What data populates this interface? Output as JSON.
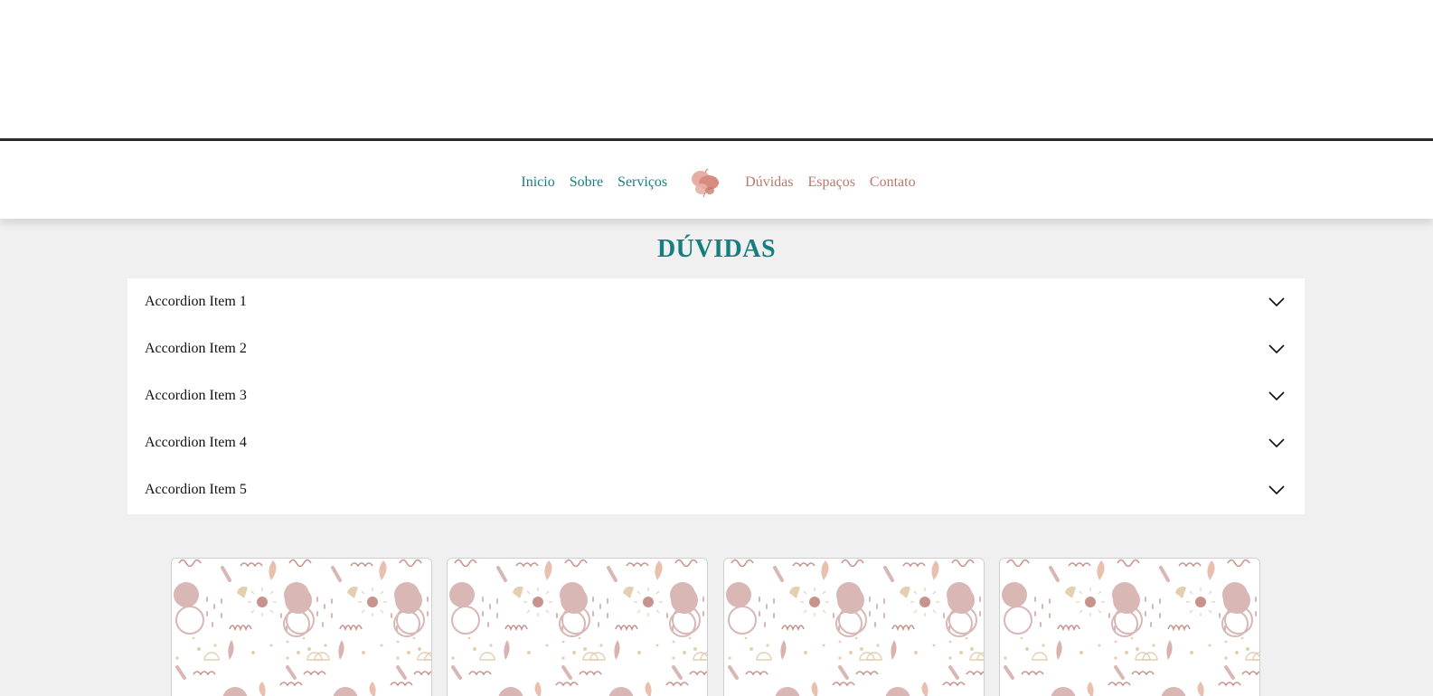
{
  "nav": {
    "left_links": [
      "Inicio",
      "Sobre",
      "Serviços"
    ],
    "right_links": [
      "Dúvidas",
      "Espaços",
      "Contato"
    ],
    "logo_icon": "butterfly-logo-icon",
    "colors": {
      "left": "#177e80",
      "right": "#b8786a"
    }
  },
  "faq": {
    "title": "DÚVIDAS",
    "items": [
      {
        "label": "Accordion Item 1"
      },
      {
        "label": "Accordion Item 2"
      },
      {
        "label": "Accordion Item 3"
      },
      {
        "label": "Accordion Item 4"
      },
      {
        "label": "Accordion Item 5"
      }
    ]
  },
  "cards": {
    "count": 4,
    "pattern": "boho-abstract-pattern",
    "colors": {
      "mauve": "#d8b7b5",
      "rose": "#c9938d",
      "sand": "#e4cfb0",
      "peach": "#e9bfae"
    }
  }
}
